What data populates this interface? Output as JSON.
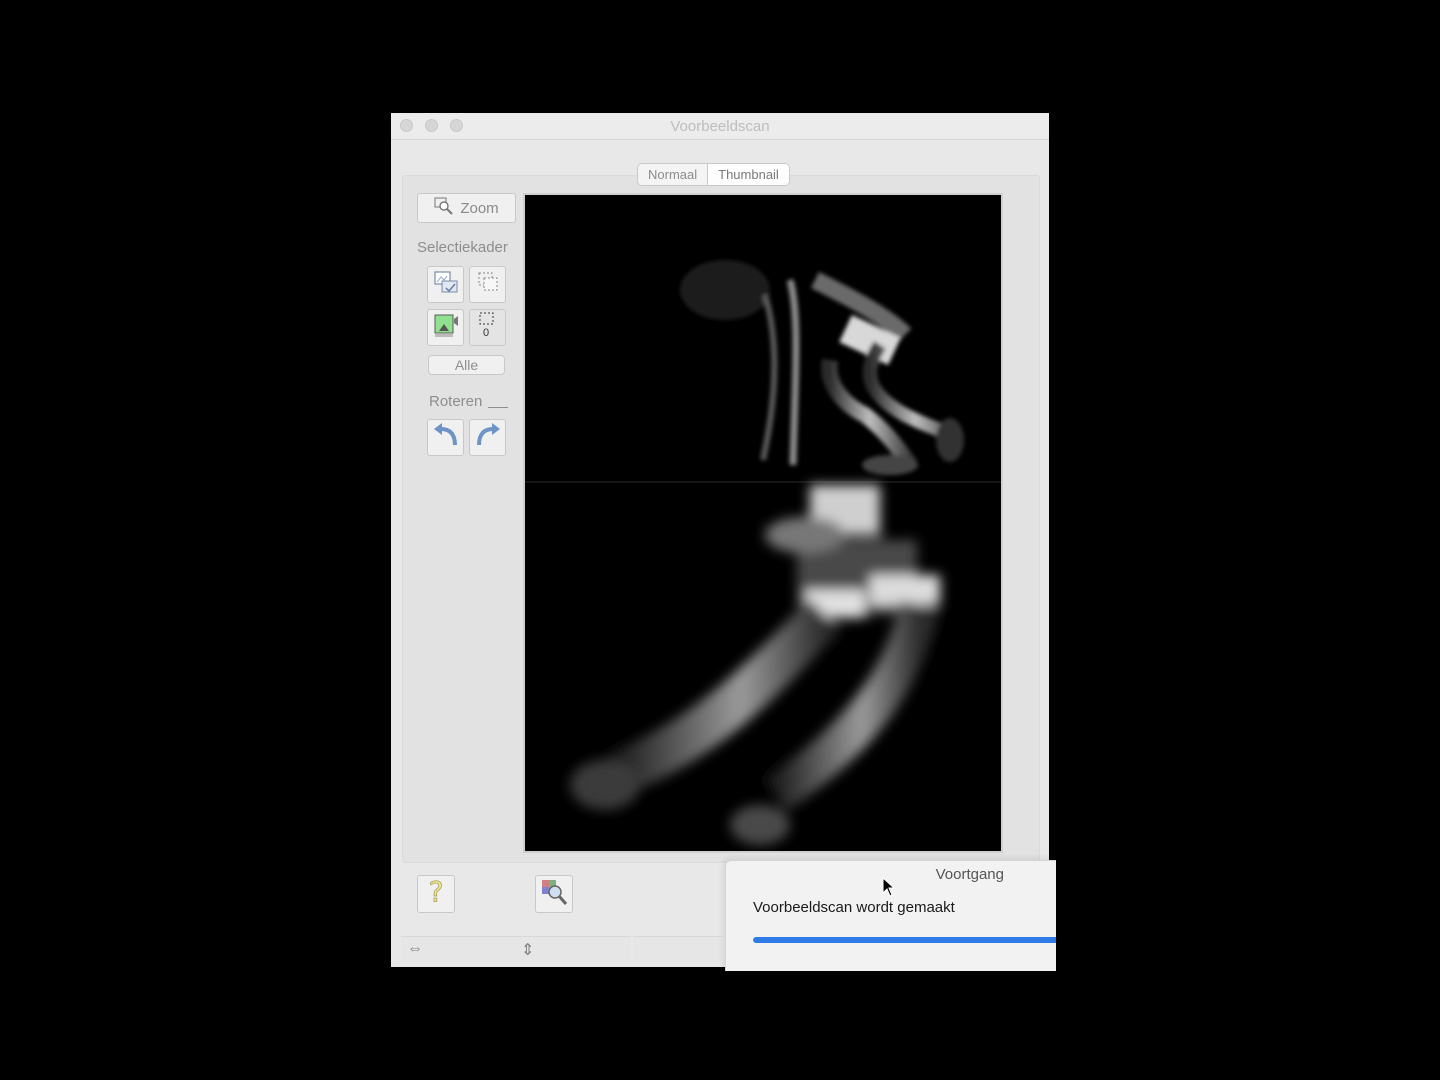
{
  "window": {
    "title": "Voorbeeldscan",
    "tabs": [
      {
        "label": "Normaal",
        "active": false
      },
      {
        "label": "Thumbnail",
        "active": true
      }
    ]
  },
  "sidebar": {
    "zoom_label": "Zoom",
    "selection_heading": "Selectiekader",
    "all_label": "Alle",
    "rotate_heading": "Roteren",
    "frame_count": "0"
  },
  "preview": {
    "description_icon": "sprinter-photo"
  },
  "progress": {
    "title": "Voortgang",
    "message": "Voorbeeldscan wordt gemaakt",
    "value_percent": 100,
    "bar_color": "#2f7be6"
  },
  "colors": {
    "accent": "#2f7be6",
    "window_bg": "#e8e8e8",
    "desktop": "#000000"
  }
}
